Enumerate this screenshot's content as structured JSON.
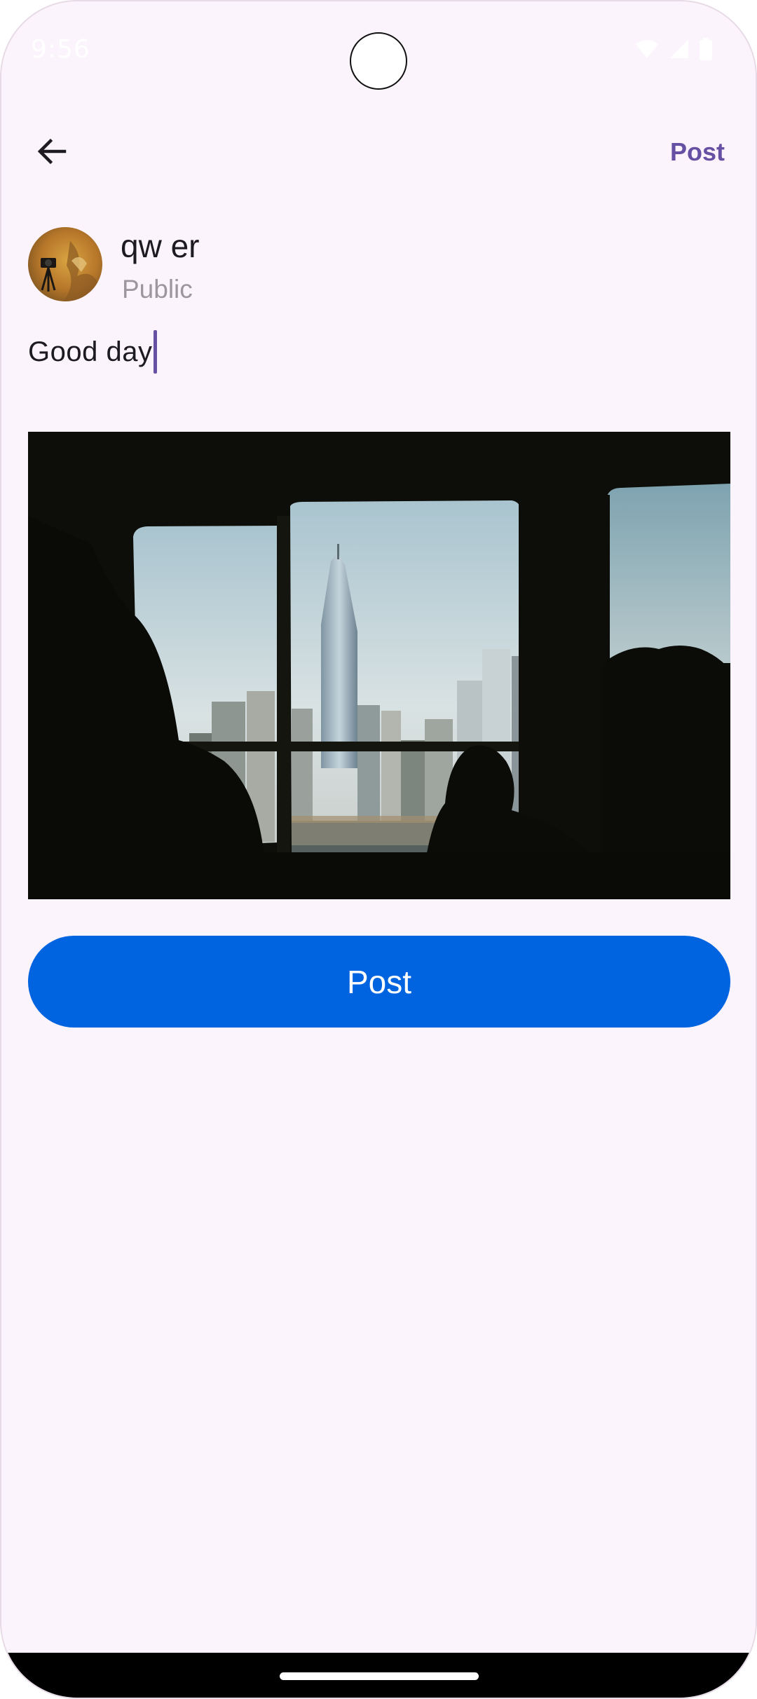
{
  "status_bar": {
    "time": "9:56",
    "icons": [
      "wifi-icon",
      "signal-icon",
      "battery-icon"
    ]
  },
  "app_bar": {
    "back_icon": "arrow-back-icon",
    "action_label": "Post"
  },
  "author": {
    "name": "qw er",
    "visibility": "Public"
  },
  "composer": {
    "text": "Good day"
  },
  "attachment": {
    "type": "photo",
    "subject": "city skyline seen through a ferry window"
  },
  "primary_button": {
    "label": "Post"
  },
  "colors": {
    "background": "#fcf4fc",
    "accent": "#6650a4",
    "primary_button": "#0064e1",
    "text_primary": "#1d1b20",
    "text_secondary": "#9b979d"
  }
}
